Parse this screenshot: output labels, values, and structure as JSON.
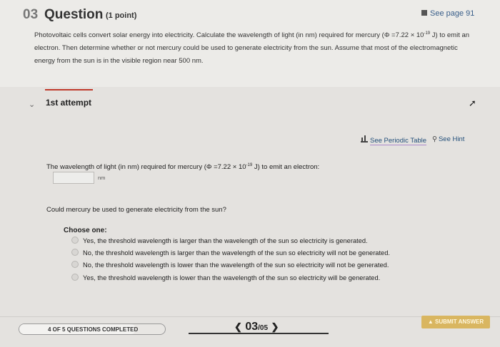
{
  "question": {
    "number": "03",
    "title": "Question",
    "points": "(1 point)",
    "see_page": "See page 91",
    "text_line1_a": "Photovoltaic cells convert solar energy into electricity. Calculate the wavelength of light (in nm) required for mercury (Φ =7.22 × 10",
    "text_line1_exp": "-19",
    "text_line1_b": " J) to emit an",
    "text_line2": "electron. Then determine whether or not mercury could be used to generate electricity from the sun. Assume that most of the electromagnetic",
    "text_line3": "energy from the sun is in the visible region near 500 nm."
  },
  "attempt": {
    "label": "1st attempt"
  },
  "tools": {
    "periodic_table": "See Periodic Table",
    "hint": "See Hint"
  },
  "part1": {
    "prompt_a": "The wavelength of light (in nm) required for mercury (Φ =7.22 × 10",
    "prompt_exp": "-19",
    "prompt_b": " J) to emit an electron:",
    "answer_value": "",
    "unit": "nm"
  },
  "part2": {
    "prompt": "Could mercury be used to generate electricity from the sun?",
    "choose_label": "Choose one:",
    "options": [
      "Yes, the threshold wavelength is larger than the wavelength of the sun so electricity is generated.",
      "No, the threshold wavelength is larger than the wavelength of the sun so electricity will not be generated.",
      "No, the threshold wavelength is lower than the wavelength of the sun so electricity will not be generated.",
      "Yes, the threshold wavelength is lower than the wavelength of the sun so electricity will be generated."
    ]
  },
  "footer": {
    "progress_text": "4 OF 5 QUESTIONS COMPLETED",
    "progress_fraction": 0.8,
    "current": "03",
    "total": "/05",
    "submit_label": "SUBMIT ANSWER"
  }
}
